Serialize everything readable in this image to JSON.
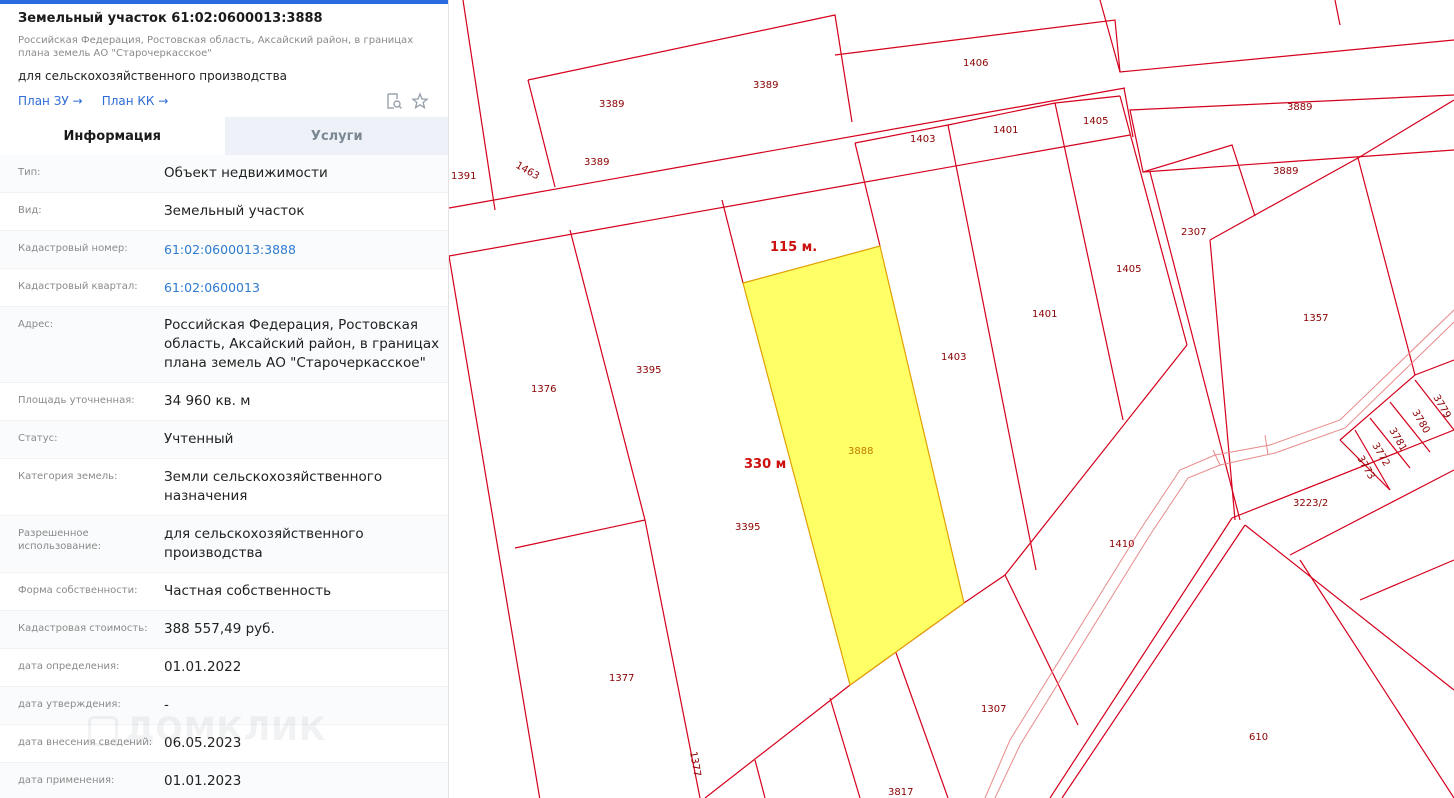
{
  "header": {
    "title": "Земельный участок 61:02:0600013:3888",
    "address": "Российская Федерация, Ростовская область, Аксайский район, в границах плана земель АО \"Старочеркасское\"",
    "purpose": "для сельскохозяйственного производства",
    "plan_zu": "План ЗУ →",
    "plan_kk": "План КК →"
  },
  "tabs": {
    "info": "Информация",
    "services": "Услуги"
  },
  "rows": [
    {
      "label": "Тип:",
      "value": "Объект недвижимости"
    },
    {
      "label": "Вид:",
      "value": "Земельный участок"
    },
    {
      "label": "Кадастровый номер:",
      "value": "61:02:0600013:3888"
    },
    {
      "label": "Кадастровый квартал:",
      "value": "61:02:0600013"
    },
    {
      "label": "Адрес:",
      "value": "Российская Федерация, Ростовская область, Аксайский район, в границах плана земель АО \"Старочеркасское\""
    },
    {
      "label": "Площадь уточненная:",
      "value": "34 960 кв. м"
    },
    {
      "label": "Статус:",
      "value": "Учтенный"
    },
    {
      "label": "Категория земель:",
      "value": "Земли сельскохозяйственного назначения"
    },
    {
      "label": "Разрешенное использование:",
      "value": "для сельскохозяйственного производства"
    },
    {
      "label": "Форма собственности:",
      "value": "Частная собственность"
    },
    {
      "label": "Кадастровая стоимость:",
      "value": "388 557,49 руб."
    },
    {
      "label": "дата определения:",
      "value": "01.01.2022"
    },
    {
      "label": "дата утверждения:",
      "value": "-"
    },
    {
      "label": "дата внесения сведений:",
      "value": "06.05.2023"
    },
    {
      "label": "дата применения:",
      "value": "01.01.2023"
    }
  ],
  "watermark": "ДОМКЛИК",
  "map": {
    "selected_plot": "3888",
    "dimension_top": "115 м.",
    "dimension_side": "330 м",
    "plot_labels": [
      "1406",
      "3389",
      "3389",
      "3389",
      "3889",
      "3889",
      "1403",
      "1401",
      "1405",
      "1405",
      "1401",
      "1403",
      "1391",
      "1463",
      "2307",
      "1357",
      "1376",
      "3395",
      "3395",
      "3888",
      "1377",
      "1377",
      "1410",
      "1307",
      "3817",
      "610",
      "3223/2",
      "3773",
      "3772",
      "3781",
      "3780",
      "3779"
    ]
  },
  "colors": {
    "accent": "#2b6be0",
    "boundary": "#d5001c",
    "selected_fill": "#ffff66",
    "link": "#2f7bd0"
  }
}
